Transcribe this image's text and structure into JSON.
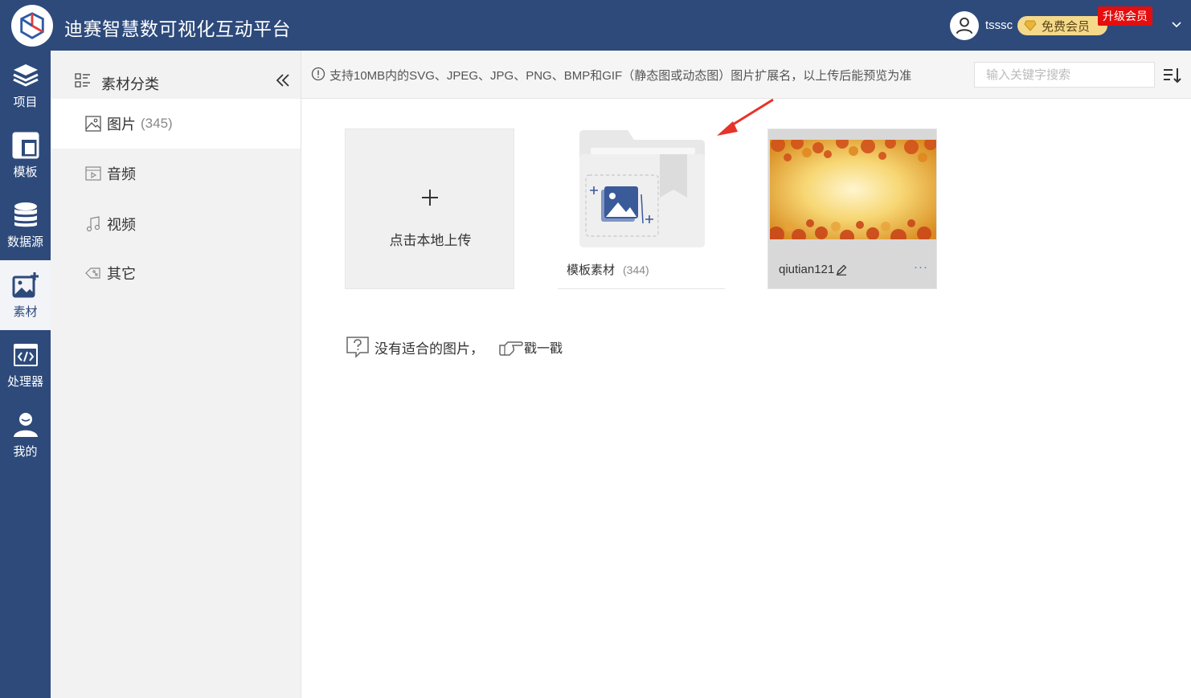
{
  "header": {
    "app_title": "迪赛智慧数可视化互动平台",
    "username": "tsssc",
    "member_badge": "免费会员",
    "upgrade_tag": "升级会员"
  },
  "rail": {
    "items": [
      {
        "label": "项目"
      },
      {
        "label": "模板"
      },
      {
        "label": "数据源"
      },
      {
        "label": "素材"
      },
      {
        "label": "处理器"
      },
      {
        "label": "我的"
      }
    ]
  },
  "category_panel": {
    "title": "素材分类",
    "items": [
      {
        "label": "图片",
        "count": "(345)"
      },
      {
        "label": "音频"
      },
      {
        "label": "视频"
      },
      {
        "label": "其它"
      }
    ]
  },
  "toolbar": {
    "notice": "支持10MB内的SVG、JPEG、JPG、PNG、BMP和GIF（静态图或动态图）图片扩展名，以上传后能预览为准",
    "search_placeholder": "输入关键字搜索"
  },
  "grid": {
    "upload_label": "点击本地上传",
    "folder": {
      "name": "模板素材",
      "count": "(344)"
    },
    "image": {
      "name": "qiutian121",
      "more": "···"
    }
  },
  "hint": {
    "text": "没有适合的图片，",
    "link": "戳一戳"
  },
  "colors": {
    "brand": "#2d4a7b",
    "accent_red": "#e50d0d",
    "badge_gold": "#f5d98b"
  }
}
